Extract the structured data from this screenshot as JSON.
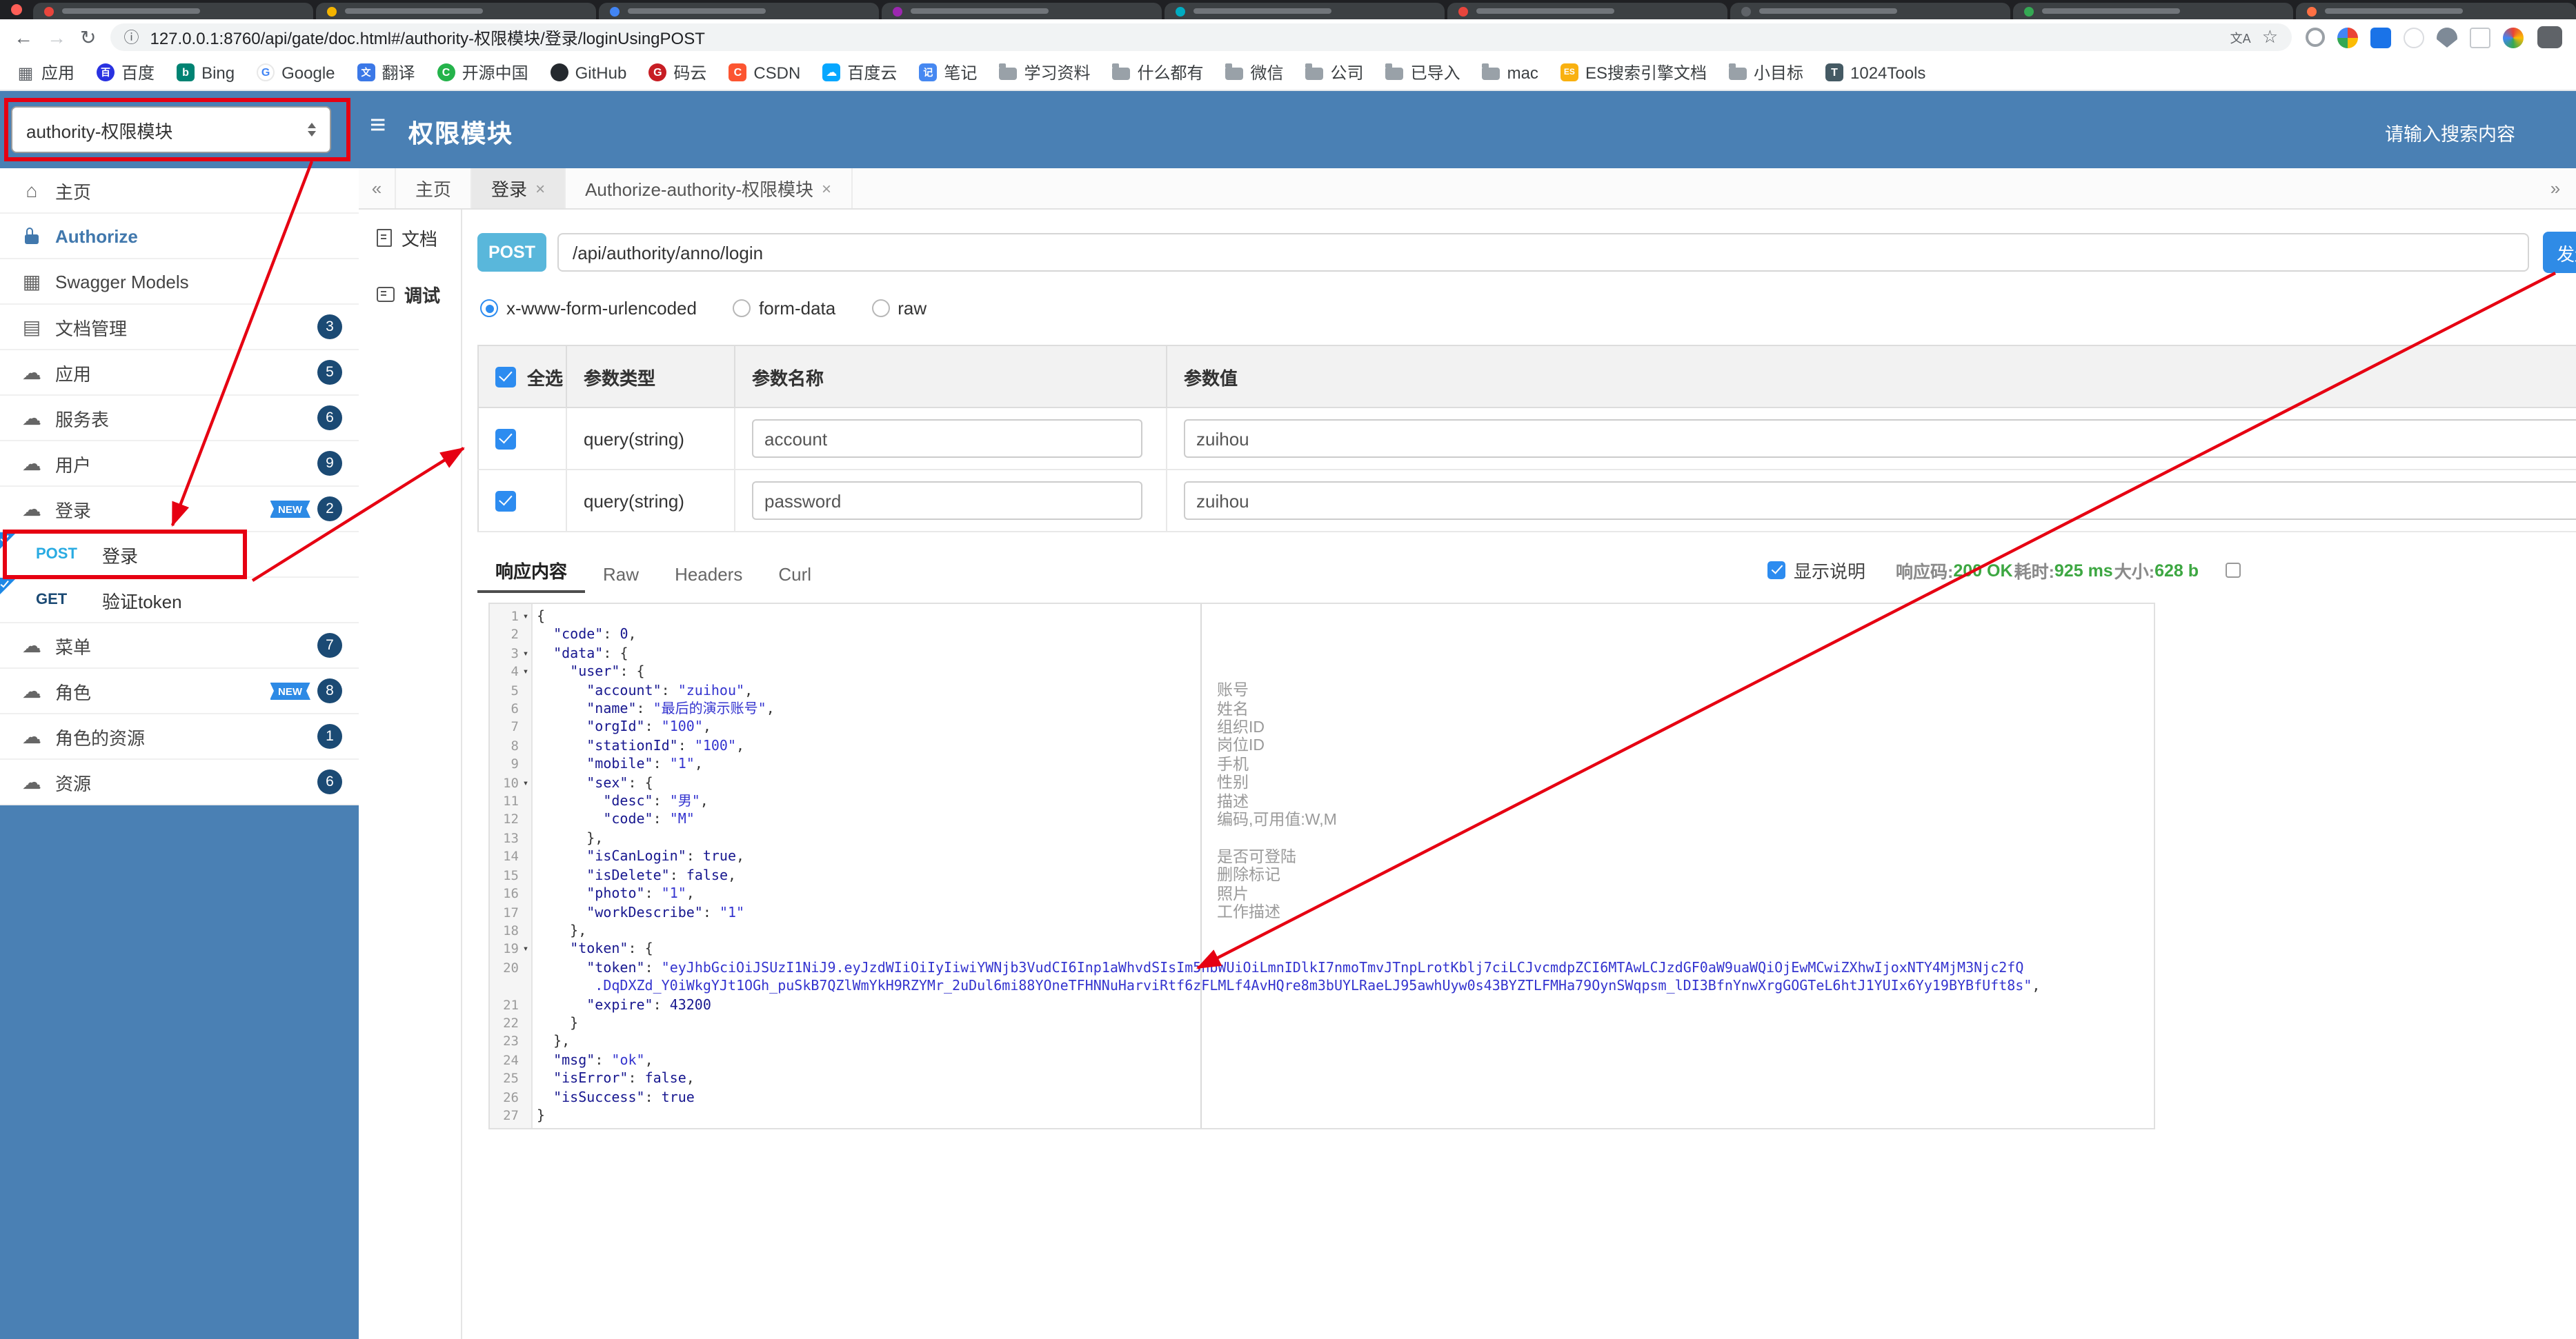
{
  "colors": {
    "header_blue": "#4a80b4",
    "badge_navy": "#1b4a74",
    "post_blue": "#59b7db",
    "annotation_red": "#e60012",
    "success_green": "#3da742",
    "accent_blue": "#2d8cf0"
  },
  "icons": {
    "back": "←",
    "forward": "→",
    "reload": "↻",
    "info": "ⓘ",
    "translate": "文A",
    "star": "☆",
    "burger": "≡",
    "chevron_left": "«",
    "chevron_right": "»",
    "close": "×",
    "fold": "▾",
    "home": "⌂",
    "models": "▦",
    "doc": "▤",
    "cloud": "☁"
  },
  "browser": {
    "url": "127.0.0.1:8760/api/gate/doc.html#/authority-权限模块/登录/loginUsingPOST",
    "tab_favicon_colors": [
      "#e8453c",
      "#f4b400",
      "#4285f4",
      "#9c27b0",
      "#00acc1",
      "#e8453c",
      "#5f6368",
      "#34a853",
      "#ff7043"
    ],
    "bookmarks": [
      {
        "icon": "apps",
        "label": "应用"
      },
      {
        "icon": "baidu",
        "label": "百度"
      },
      {
        "icon": "bing",
        "label": "Bing"
      },
      {
        "icon": "google",
        "label": "Google"
      },
      {
        "icon": "translate",
        "label": "翻译"
      },
      {
        "icon": "oschina",
        "label": "开源中国"
      },
      {
        "icon": "github",
        "label": "GitHub"
      },
      {
        "icon": "gitee",
        "label": "码云"
      },
      {
        "icon": "csdn",
        "label": "CSDN"
      },
      {
        "icon": "baiduyun",
        "label": "百度云"
      },
      {
        "icon": "note",
        "label": "笔记"
      },
      {
        "icon": "folder",
        "label": "学习资料"
      },
      {
        "icon": "folder",
        "label": "什么都有"
      },
      {
        "icon": "folder",
        "label": "微信"
      },
      {
        "icon": "folder",
        "label": "公司"
      },
      {
        "icon": "folder",
        "label": "已导入"
      },
      {
        "icon": "folder",
        "label": "mac"
      },
      {
        "icon": "es",
        "label": "ES搜索引擎文档"
      },
      {
        "icon": "folder",
        "label": "小目标"
      },
      {
        "icon": "tools",
        "label": "1024Tools"
      }
    ]
  },
  "header": {
    "group_select": "authority-权限模块",
    "title": "权限模块",
    "search_placeholder": "请输入搜索内容"
  },
  "sidebar": {
    "new_label": "NEW",
    "items": [
      {
        "icon": "home",
        "label": "主页"
      },
      {
        "icon": "lock",
        "label": "Authorize",
        "highlight": true
      },
      {
        "icon": "models",
        "label": "Swagger Models"
      },
      {
        "icon": "doc",
        "label": "文档管理",
        "badge": 3
      },
      {
        "icon": "cloud",
        "label": "应用",
        "badge": 5
      },
      {
        "icon": "cloud",
        "label": "服务表",
        "badge": 6
      },
      {
        "icon": "cloud",
        "label": "用户",
        "badge": 9
      },
      {
        "icon": "cloud",
        "label": "登录",
        "badge": 2,
        "isNew": true,
        "children": [
          {
            "method": "POST",
            "label": "登录"
          },
          {
            "method": "GET",
            "label": "验证token"
          }
        ]
      },
      {
        "icon": "cloud",
        "label": "菜单",
        "badge": 7
      },
      {
        "icon": "cloud",
        "label": "角色",
        "badge": 8,
        "isNew": true
      },
      {
        "icon": "cloud",
        "label": "角色的资源",
        "badge": 1
      },
      {
        "icon": "cloud",
        "label": "资源",
        "badge": 6
      }
    ]
  },
  "doc_tabs": {
    "tabs": [
      {
        "label": "主页",
        "closable": false
      },
      {
        "label": "登录",
        "closable": true,
        "active": true
      },
      {
        "label": "Authorize-authority-权限模块",
        "closable": true
      }
    ]
  },
  "inner_menu": {
    "items": [
      {
        "label": "文档",
        "icon": "docpage"
      },
      {
        "label": "调试",
        "icon": "debug",
        "active": true
      }
    ]
  },
  "request": {
    "method": "POST",
    "path": "/api/authority/anno/login",
    "send_label": "发送",
    "content_types": [
      {
        "label": "x-www-form-urlencoded",
        "selected": true
      },
      {
        "label": "form-data",
        "selected": false
      },
      {
        "label": "raw",
        "selected": false
      }
    ],
    "params_table": {
      "headers": [
        "全选",
        "参数类型",
        "参数名称",
        "参数值"
      ],
      "rows": [
        {
          "checked": true,
          "type": "query(string)",
          "name": "account",
          "value": "zuihou"
        },
        {
          "checked": true,
          "type": "query(string)",
          "name": "password",
          "value": "zuihou"
        }
      ]
    }
  },
  "response": {
    "tabs": [
      {
        "label": "响应内容",
        "active": true
      },
      {
        "label": "Raw",
        "active": false
      },
      {
        "label": "Headers",
        "active": false
      },
      {
        "label": "Curl",
        "active": false
      }
    ],
    "show_desc_label": "显示说明",
    "meta": [
      {
        "label": "响应码:",
        "value": "200 OK"
      },
      {
        "label": "耗时:",
        "value": "925 ms"
      },
      {
        "label": "大小:",
        "value": "628 b"
      }
    ],
    "json_lines": [
      {
        "n": 1,
        "fold": true,
        "t": "{"
      },
      {
        "n": 2,
        "t": "  \"code\": 0,"
      },
      {
        "n": 3,
        "fold": true,
        "t": "  \"data\": {"
      },
      {
        "n": 4,
        "fold": true,
        "t": "    \"user\": {"
      },
      {
        "n": 5,
        "t": "      \"account\": \"zuihou\",",
        "a": "账号"
      },
      {
        "n": 6,
        "t": "      \"name\": \"最后的演示账号\",",
        "a": "姓名"
      },
      {
        "n": 7,
        "t": "      \"orgId\": \"100\",",
        "a": "组织ID"
      },
      {
        "n": 8,
        "t": "      \"stationId\": \"100\",",
        "a": "岗位ID"
      },
      {
        "n": 9,
        "t": "      \"mobile\": \"1\",",
        "a": "手机"
      },
      {
        "n": 10,
        "fold": true,
        "t": "      \"sex\": {",
        "a": "性别"
      },
      {
        "n": 11,
        "t": "        \"desc\": \"男\",",
        "a": "描述"
      },
      {
        "n": 12,
        "t": "        \"code\": \"M\"",
        "a": "编码,可用值:W,M"
      },
      {
        "n": 13,
        "t": "      },"
      },
      {
        "n": 14,
        "t": "      \"isCanLogin\": true,",
        "a": "是否可登陆"
      },
      {
        "n": 15,
        "t": "      \"isDelete\": false,",
        "a": "删除标记"
      },
      {
        "n": 16,
        "t": "      \"photo\": \"1\",",
        "a": "照片"
      },
      {
        "n": 17,
        "t": "      \"workDescribe\": \"1\"",
        "a": "工作描述"
      },
      {
        "n": 18,
        "t": "    },"
      },
      {
        "n": 19,
        "fold": true,
        "t": "    \"token\": {"
      },
      {
        "n": 20,
        "t": "      \"token\": \"eyJhbGciOiJSUzI1NiJ9.eyJzdWIiOiIyIiwiYWNjb3VudCI6Inp1aWhvdSIsIm5hbWUiOiLmnIDlkI7nmoTmvJTnpLrotKblj7ciLCJvcmdpZCI6MTAwLCJzdGF0aW9uaWQiOjEwMCwiZXhwIjoxNTY4MjM3Njc2fQ\n       .DqDXZd_Y0iWkgYJt1OGh_puSkB7QZlWmYkH9RZYMr_2uDul6mi88YOneTFHNNuHarviRtf6zFLMLf4AvHQre8m3bUYLRaeLJ95awhUyw0s43BYZTLFMHa79OynSWqpsm_lDI3BfnYnwXrgGOGTeL6htJ1YUIx6Yy19BYBfUft8s\","
      },
      {
        "n": 21,
        "t": "      \"expire\": 43200"
      },
      {
        "n": 22,
        "t": "    }"
      },
      {
        "n": 23,
        "t": "  },"
      },
      {
        "n": 24,
        "t": "  \"msg\": \"ok\","
      },
      {
        "n": 25,
        "t": "  \"isError\": false,"
      },
      {
        "n": 26,
        "t": "  \"isSuccess\": true"
      },
      {
        "n": 27,
        "t": "}"
      }
    ]
  }
}
